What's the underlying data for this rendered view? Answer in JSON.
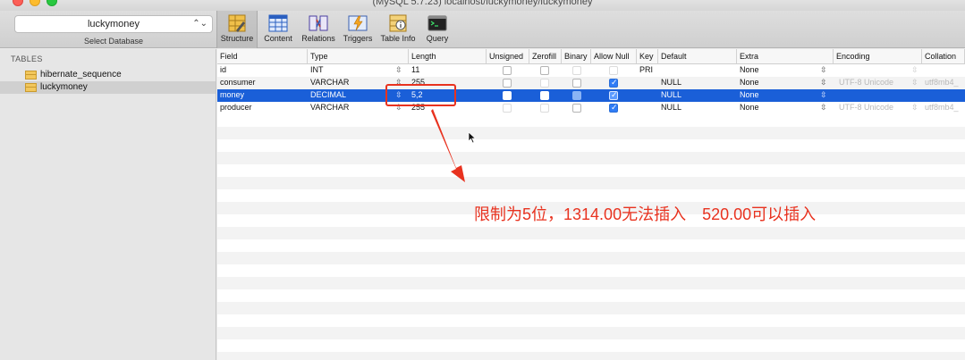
{
  "window": {
    "title": "(MySQL 5.7.23) localhost/luckymoney/luckymoney"
  },
  "toolbar": {
    "database": "luckymoney",
    "database_caption": "Select Database",
    "tools": [
      {
        "label": "Structure"
      },
      {
        "label": "Content"
      },
      {
        "label": "Relations"
      },
      {
        "label": "Triggers"
      },
      {
        "label": "Table Info"
      },
      {
        "label": "Query"
      }
    ]
  },
  "sidebar": {
    "heading": "TABLES",
    "items": [
      {
        "label": "hibernate_sequence"
      },
      {
        "label": "luckymoney"
      }
    ]
  },
  "table": {
    "columns": [
      "Field",
      "Type",
      "Length",
      "Unsigned",
      "Zerofill",
      "Binary",
      "Allow Null",
      "Key",
      "Default",
      "Extra",
      "Encoding",
      "Collation"
    ],
    "rows": [
      {
        "field": "id",
        "type": "INT",
        "length": "11",
        "unsigned": false,
        "zerofill": false,
        "binary": false,
        "allow_null": false,
        "key": "PRI",
        "default": "",
        "extra": "None",
        "encoding": "",
        "collation": ""
      },
      {
        "field": "consumer",
        "type": "VARCHAR",
        "length": "255",
        "unsigned": false,
        "zerofill": false,
        "binary": false,
        "allow_null": true,
        "key": "",
        "default": "NULL",
        "extra": "None",
        "encoding": "UTF-8 Unicode",
        "collation": "utf8mb4_"
      },
      {
        "field": "money",
        "type": "DECIMAL",
        "length": "5,2",
        "unsigned": false,
        "zerofill": false,
        "binary": false,
        "allow_null": true,
        "key": "",
        "default": "NULL",
        "extra": "None",
        "encoding": "",
        "collation": ""
      },
      {
        "field": "producer",
        "type": "VARCHAR",
        "length": "255",
        "unsigned": false,
        "zerofill": false,
        "binary": false,
        "allow_null": true,
        "key": "",
        "default": "NULL",
        "extra": "None",
        "encoding": "UTF-8 Unicode",
        "collation": "utf8mb4_"
      }
    ]
  },
  "annotation": {
    "text": "限制为5位，1314.00无法插入　520.00可以插入",
    "color": "#e8321f"
  },
  "colors": {
    "selection": "#1a5fd8",
    "accent_red": "#e8321f"
  }
}
